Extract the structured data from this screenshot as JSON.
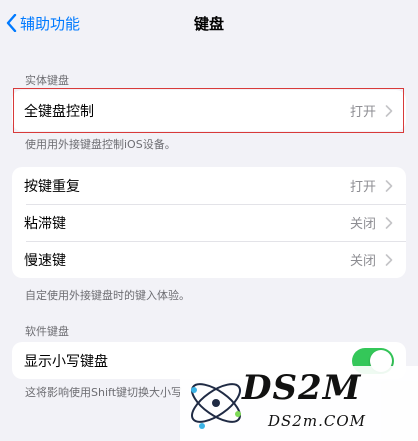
{
  "nav": {
    "back_label": "辅助功能",
    "title": "键盘"
  },
  "hardware_section": {
    "header": "实体键盘",
    "full_keyboard_access": {
      "label": "全键盘控制",
      "value": "打开"
    },
    "footer": "使用用外接键盘控制iOS设备。",
    "rows": [
      {
        "label": "按键重复",
        "value": "打开"
      },
      {
        "label": "粘滞键",
        "value": "关闭"
      },
      {
        "label": "慢速键",
        "value": "关闭"
      }
    ],
    "rows_footer": "自定使用外接键盘时的键入体验。"
  },
  "software_section": {
    "header": "软件键盘",
    "lowercase": {
      "label": "显示小写键盘",
      "on": true
    },
    "footer": "这将影响使用Shift键切换大小写"
  },
  "watermark": {
    "logo_text": "DS2M",
    "domain": "DS2m.COM"
  },
  "colors": {
    "accent": "#007aff",
    "toggle_on": "#34c759",
    "highlight_border": "#d83a3a",
    "background": "#f2f2f7"
  }
}
